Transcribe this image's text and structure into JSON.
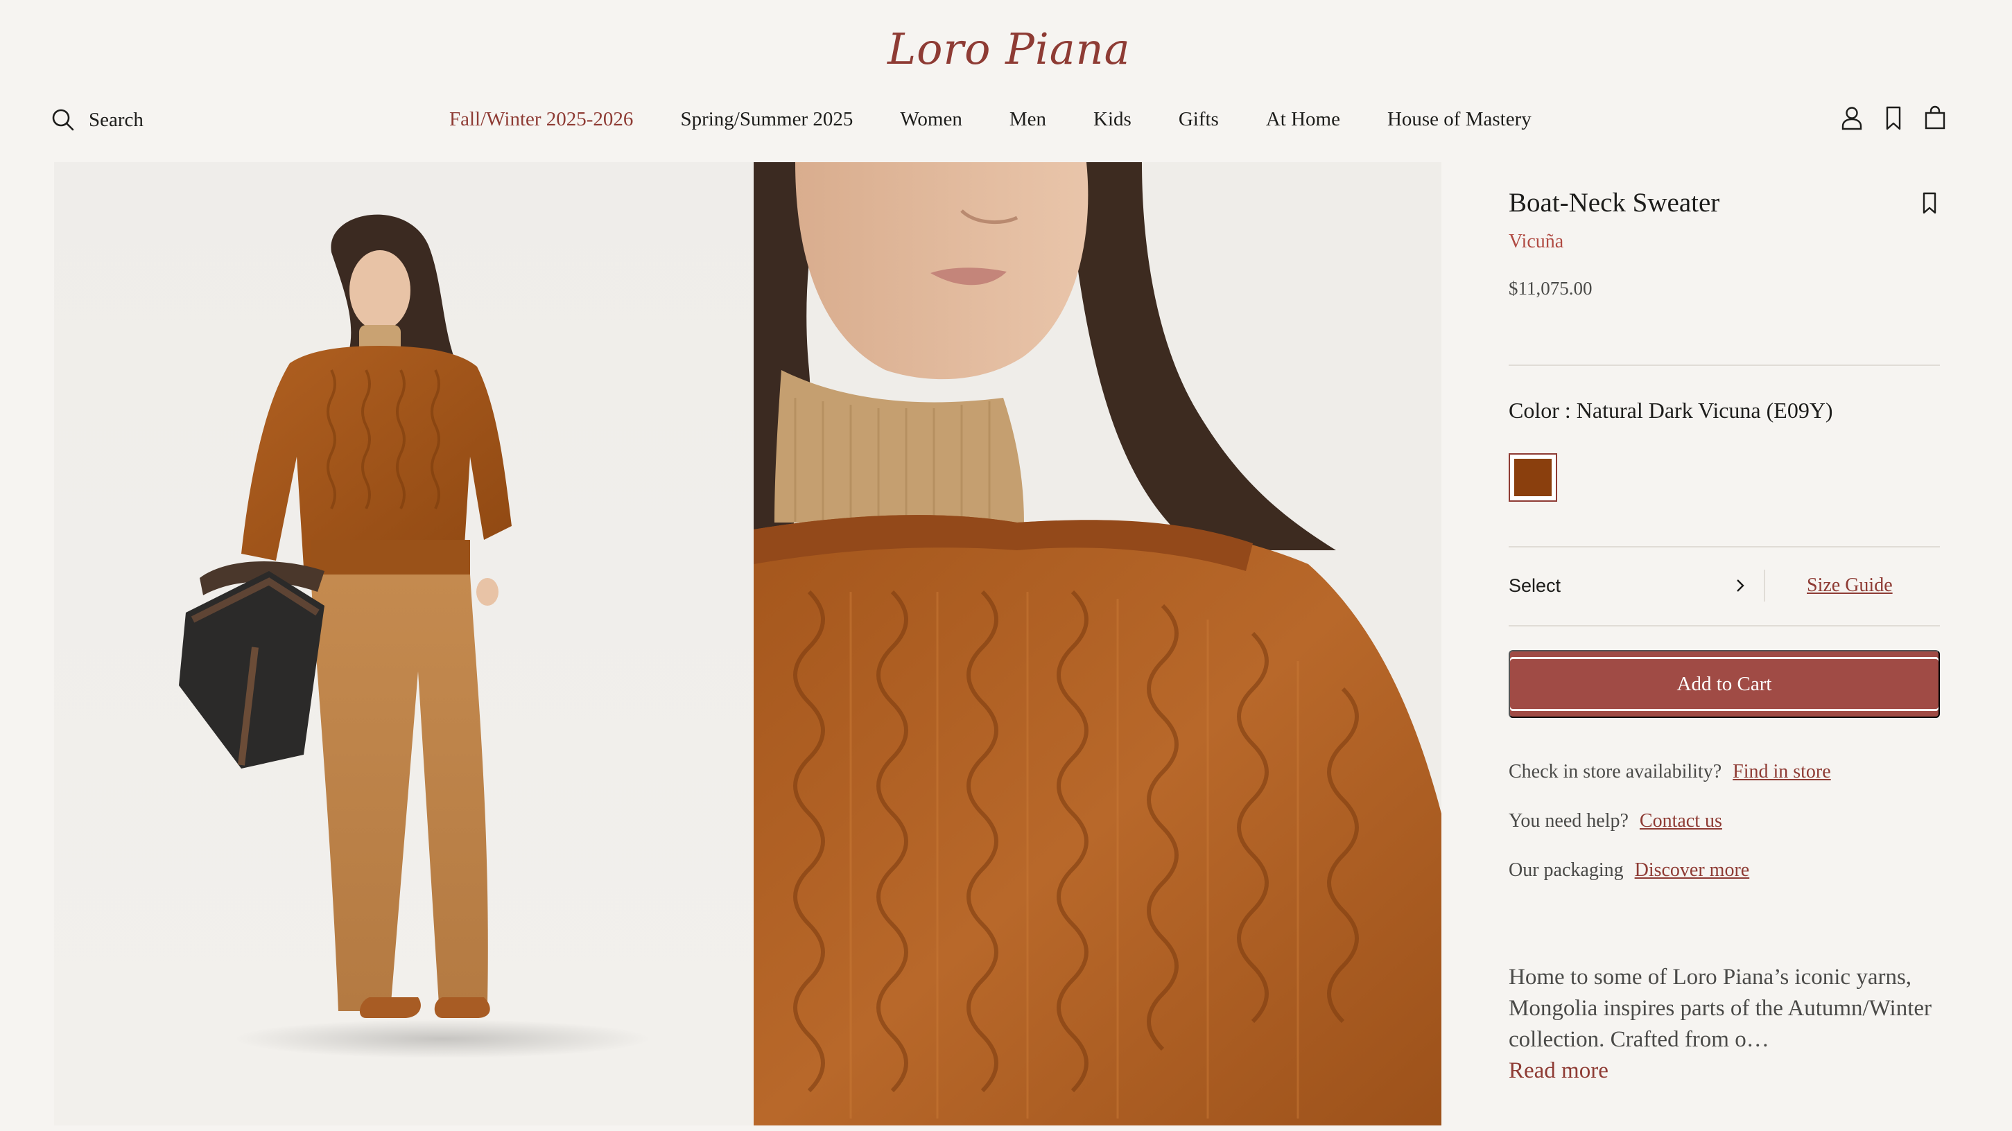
{
  "brand": {
    "name": "Loro Piana",
    "accent": "#8e3b34"
  },
  "header": {
    "search_label": "Search",
    "nav": [
      {
        "label": "Fall/Winter 2025-2026",
        "active": true
      },
      {
        "label": "Spring/Summer 2025"
      },
      {
        "label": "Women"
      },
      {
        "label": "Men"
      },
      {
        "label": "Kids"
      },
      {
        "label": "Gifts"
      },
      {
        "label": "At Home"
      },
      {
        "label": "House of Mastery"
      }
    ],
    "icons": [
      "account-icon",
      "bookmark-icon",
      "shopping-bag-icon"
    ]
  },
  "gallery": {
    "images": [
      "full-length model wearing cable-knit sweater and wide trousers with leather tote",
      "close-up of cable-knit sweater over turtleneck"
    ]
  },
  "product": {
    "title": "Boat-Neck Sweater",
    "material": "Vicuña",
    "price": "$11,075.00",
    "color_label": "Color : Natural Dark Vicuna (E09Y)",
    "swatch_color": "#8a3f0d",
    "size_select_label": "Select",
    "size_guide_label": "Size Guide",
    "add_to_cart_label": "Add to Cart",
    "store_question": "Check in store availability?",
    "store_link": "Find in store",
    "help_question": "You need help?",
    "help_link": "Contact us",
    "packaging_label": "Our packaging",
    "packaging_link": "Discover more",
    "description": "Home to some of Loro Piana’s iconic yarns, Mongolia inspires parts of the Autumn/Winter collection. Crafted from o…",
    "read_more_label": "Read more"
  }
}
